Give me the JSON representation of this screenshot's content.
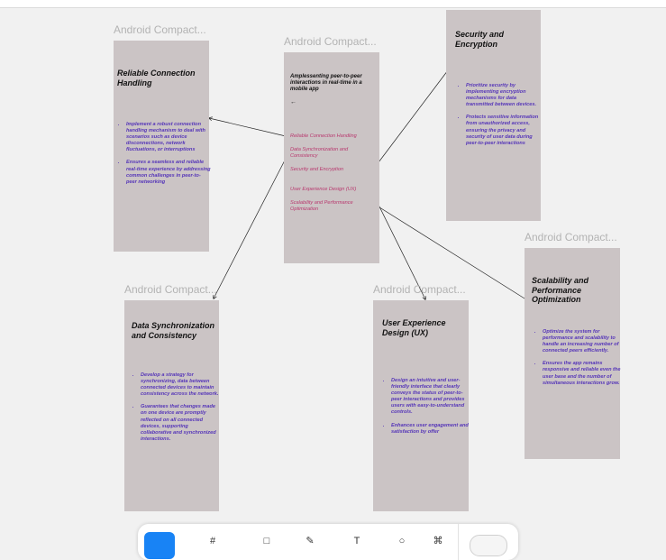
{
  "frames": {
    "main": {
      "label": "Android Compact...",
      "title": "Amplessenting peer-to-peer interactions in real-time in a mobile app",
      "back_glyph": "←",
      "menu": [
        "Reliable Connection Handling",
        "Data Synchronization and Consistency",
        "Security and Encryption",
        "User Experience Design (UX)",
        "Scalability and Performance Optimization"
      ]
    },
    "reliable": {
      "label": "Android Compact...",
      "title": "Reliable Connection Handling",
      "bullets": [
        "Implement a robust connection handling mechanism to deal with scenarios such as device disconnections, network fluctuations, or interruptions",
        "Ensures a seamless and reliable real-time experience by addressing common challenges in peer-to-peer networking"
      ]
    },
    "security": {
      "title": "Security and Encryption",
      "bullets": [
        "Prioritize security by implementing encryption mechanisms for data transmitted between devices.",
        "Protects sensitive information from unauthorized access, ensuring the privacy and security of user data during peer-to-peer interactions"
      ]
    },
    "scalability": {
      "label": "Android Compact...",
      "title": "Scalability and Performance Optimization",
      "bullets": [
        "Optimize the system for performance and scalability to handle an increasing number of connected peers efficiently.",
        "Ensures the app remains responsive and reliable even the user base and the number of simultaneous interactions grow."
      ]
    },
    "datasync": {
      "label": "Android Compact...",
      "title": "Data Synchronization and Consistency",
      "bullets": [
        "Develop a strategy for synchronizing, data between connected devices to maintain consistency across the network.",
        "Guarantees that changes made on one device are promptly reflected on all connected devices, supporting collaborative and synchronized interactions."
      ]
    },
    "ux": {
      "label": "Android Compact...",
      "title": "User Experience Design (UX)",
      "bullets": [
        "Design an intuitive and user-friendly interface that clearly conveys the status of peer-to-peer interactions and provides users with easy-to-understand controls.",
        "Enhances user engagement and satisfaction by offer"
      ]
    }
  },
  "colors": {
    "canvas": "#f1f1f1",
    "frame_fill": "#cbc4c5",
    "menu_text": "#b8386e",
    "bullet_text": "#5535b8",
    "toolbar_primary": "#1883f5"
  },
  "toolbar": {
    "icons": [
      "move-tool-icon",
      "frame-tool-icon",
      "shape-tool-icon",
      "pen-tool-icon",
      "text-tool-icon",
      "comment-tool-icon",
      "actions-icon",
      "dev-mode-toggle"
    ]
  }
}
